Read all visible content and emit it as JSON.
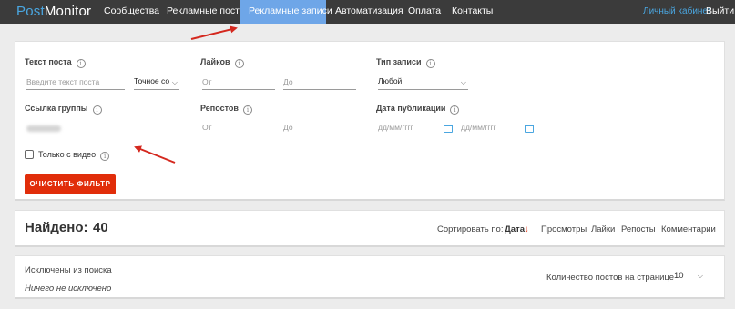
{
  "nav": {
    "logo_part1": "Post",
    "logo_part2": "Monitor",
    "items": [
      "Сообщества",
      "Рекламные посты",
      "Рекламные записи",
      "Автоматизация",
      "Оплата",
      "Контакты"
    ],
    "cabinet": "Личный кабинет",
    "logout": "Выйти"
  },
  "filters": {
    "text_label": "Текст поста",
    "text_placeholder": "Введите текст поста",
    "match_value": "Точное со",
    "likes_label": "Лайков",
    "from_placeholder": "От",
    "to_placeholder": "До",
    "type_label": "Тип записи",
    "type_value": "Любой",
    "group_label": "Ссылка группы",
    "reposts_label": "Репостов",
    "date_label": "Дата публикации",
    "date_placeholder": "дд/мм/гггг",
    "video_only_label": "Только с видео",
    "video_only_checked": false,
    "clear_button": "ОЧИСТИТЬ ФИЛЬТР"
  },
  "results": {
    "found_label": "Найдено:",
    "found_count": "40",
    "sort_label": "Сортировать по:",
    "sort_options": [
      "Дата",
      "Просмотры",
      "Лайки",
      "Репосты",
      "Комментарии"
    ],
    "sort_active_arrow": "↓"
  },
  "exclusions": {
    "title": "Исключены из поиска",
    "empty_text": "Ничего не исключено",
    "per_page_label": "Количество постов на странице",
    "per_page_value": "10"
  },
  "colors": {
    "nav_bg": "#3b3b3b",
    "nav_active": "#6ea6e8",
    "accent_blue": "#4aa6e0",
    "button_red": "#e12d0a",
    "annotation_arrow": "#d4281e"
  },
  "icons": {
    "info": "i",
    "chevron": "⌵"
  }
}
